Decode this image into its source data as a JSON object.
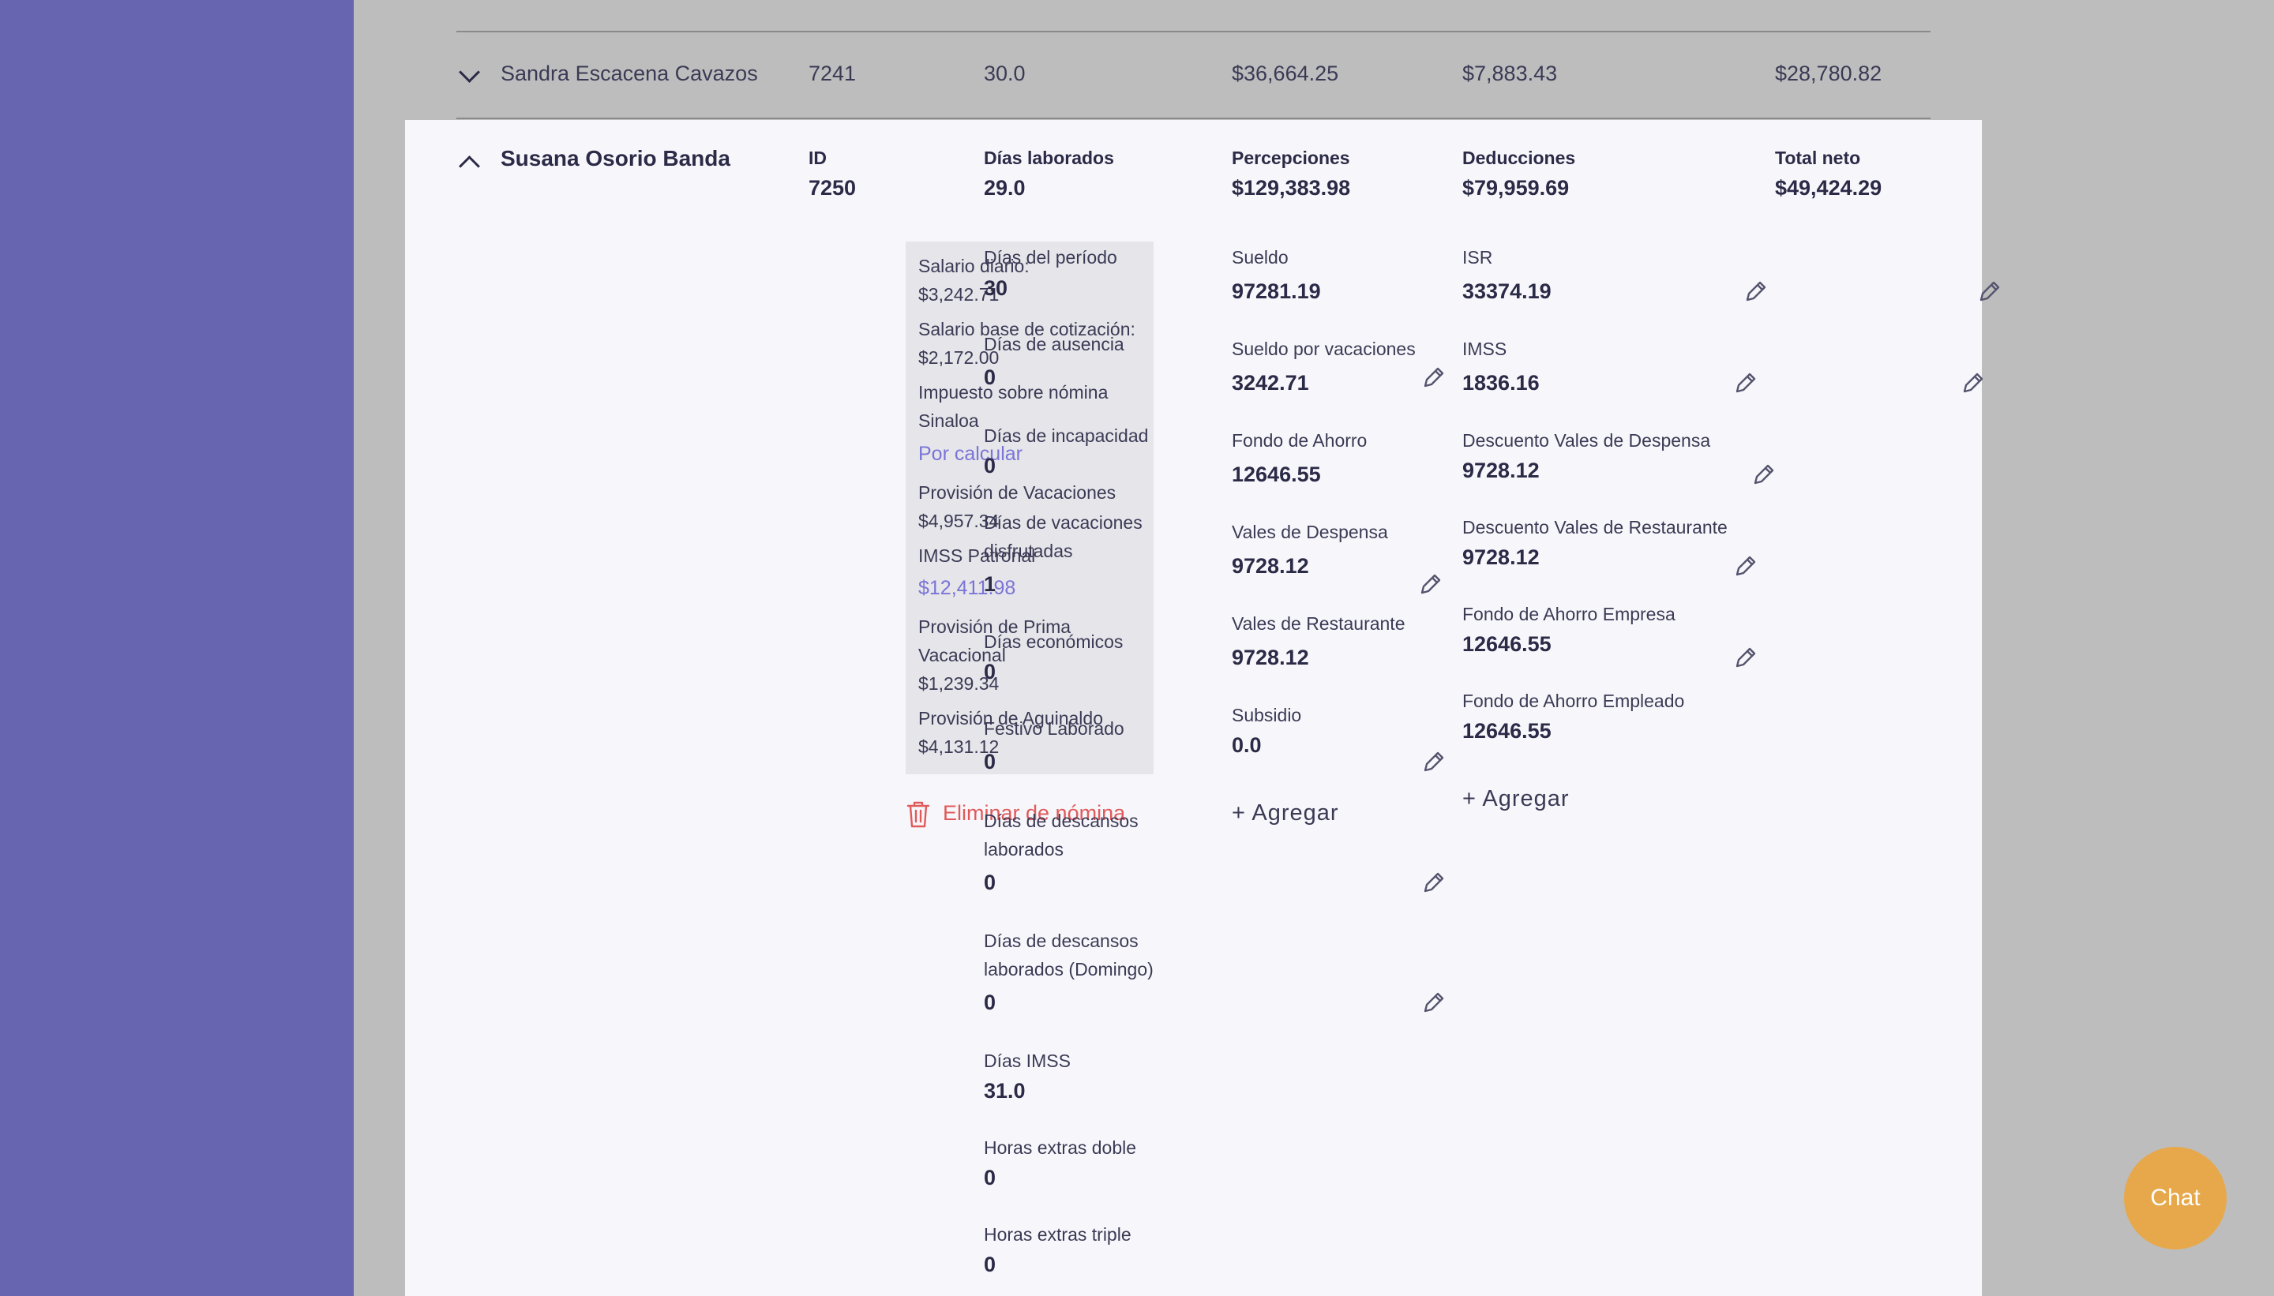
{
  "collapsed_row": {
    "name": "Sandra Escacena Cavazos",
    "id": "7241",
    "days": "30.0",
    "perceptions": "$36,664.25",
    "deductions": "$7,883.43",
    "net": "$28,780.82"
  },
  "employee": {
    "name": "Susana Osorio Banda",
    "headers": {
      "id_label": "ID",
      "id_value": "7250",
      "days_label": "Días laborados",
      "days_value": "29.0",
      "perc_label": "Percepciones",
      "perc_value": "$129,383.98",
      "ded_label": "Deducciones",
      "ded_value": "$79,959.69",
      "net_label": "Total neto",
      "net_value": "$49,424.29"
    }
  },
  "info": {
    "salario_diario_label": "Salario diario:",
    "salario_diario_value": "$3,242.71",
    "sbc_label": "Salario base de cotización:",
    "sbc_value": "$2,172.00",
    "isn_label_1": "Impuesto sobre nómina",
    "isn_label_2": "Sinaloa",
    "isn_link": "Por calcular",
    "prov_vac_label": "Provisión de Vacaciones",
    "prov_vac_value": "$4,957.34",
    "imss_patronal_label": "IMSS Patronal",
    "imss_patronal_value": "$12,411.98",
    "prima_label_1": "Provisión de Prima",
    "prima_label_2": "Vacacional",
    "prima_value": "$1,239.34",
    "aguinaldo_label": "Provisión de Aguinaldo",
    "aguinaldo_value": "$4,131.12"
  },
  "delete_label": "Eliminar de nómina",
  "days": {
    "periodo_label": "Días del período",
    "periodo_value": "30",
    "ausencia_label": "Días de ausencia",
    "ausencia_value": "0",
    "incapacidad_label": "Días de incapacidad",
    "incapacidad_value": "0",
    "vacaciones_label_1": "Días de vacaciones",
    "vacaciones_label_2": "disfrutadas",
    "vacaciones_value": "1",
    "economicos_label": "Días económicos",
    "economicos_value": "0",
    "festivo_label": "Festivo Laborado",
    "festivo_value": "0",
    "descansos_label_1": "Días de descansos",
    "descansos_label_2": "laborados",
    "descansos_value": "0",
    "descansos_dom_label_1": "Días de descansos",
    "descansos_dom_label_2": "laborados (Domingo)",
    "descansos_dom_value": "0",
    "imss_label": "Días IMSS",
    "imss_value": "31.0",
    "he_doble_label": "Horas extras doble",
    "he_doble_value": "0",
    "he_triple_label": "Horas extras triple",
    "he_triple_value": "0"
  },
  "perceptions": {
    "sueldo_label": "Sueldo",
    "sueldo_value": "97281.19",
    "sueldo_vac_label": "Sueldo por vacaciones",
    "sueldo_vac_value": "3242.71",
    "fondo_label": "Fondo de Ahorro",
    "fondo_value": "12646.55",
    "vales_desp_label": "Vales de Despensa",
    "vales_desp_value": "9728.12",
    "vales_rest_label": "Vales de Restaurante",
    "vales_rest_value": "9728.12",
    "subsidio_label": "Subsidio",
    "subsidio_value": "0.0",
    "add_label": "Agregar"
  },
  "deductions": {
    "isr_label": "ISR",
    "isr_value": "33374.19",
    "imss_label": "IMSS",
    "imss_value": "1836.16",
    "desc_desp_label": "Descuento Vales de Despensa",
    "desc_desp_value": "9728.12",
    "desc_rest_label": "Descuento Vales de Restaurante",
    "desc_rest_value": "9728.12",
    "fondo_emp_label": "Fondo de Ahorro Empresa",
    "fondo_emp_value": "12646.55",
    "fondo_empl_label": "Fondo de Ahorro Empleado",
    "fondo_empl_value": "12646.55",
    "add_label": "Agregar"
  },
  "chat_label": "Chat",
  "colors": {
    "sidebar": "#6764b0",
    "accent": "#7a74d6",
    "danger": "#e05a5a",
    "chat": "#e6a84b"
  }
}
